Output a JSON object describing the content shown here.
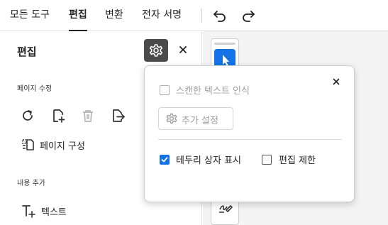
{
  "toolbar": {
    "tabs": [
      {
        "label": "모든 도구"
      },
      {
        "label": "편집"
      },
      {
        "label": "변환"
      },
      {
        "label": "전자 서명"
      }
    ],
    "active_tab": "편집",
    "undo_icon": "undo-icon",
    "redo_icon": "redo-icon"
  },
  "panel": {
    "title": "편집",
    "settings_icon": "gear-icon",
    "close_icon": "close-icon",
    "page_section": "페이지 수정",
    "page_tools": [
      "rotate-icon",
      "insert-page-icon",
      "delete-page-icon",
      "extract-page-icon"
    ],
    "organize_label": "페이지 구성",
    "content_section": "내용 추가",
    "text_label": "텍스트"
  },
  "popup": {
    "ocr_label": "스캔한 텍스트 인식",
    "ocr_checked": false,
    "more_settings_label": "추가 설정",
    "bbox_label": "테두리 상자 표시",
    "bbox_checked": true,
    "restrict_label": "편집 제한",
    "restrict_checked": false
  },
  "colors": {
    "accent": "#1473e6",
    "settings_button_bg": "#4b4b4b"
  }
}
